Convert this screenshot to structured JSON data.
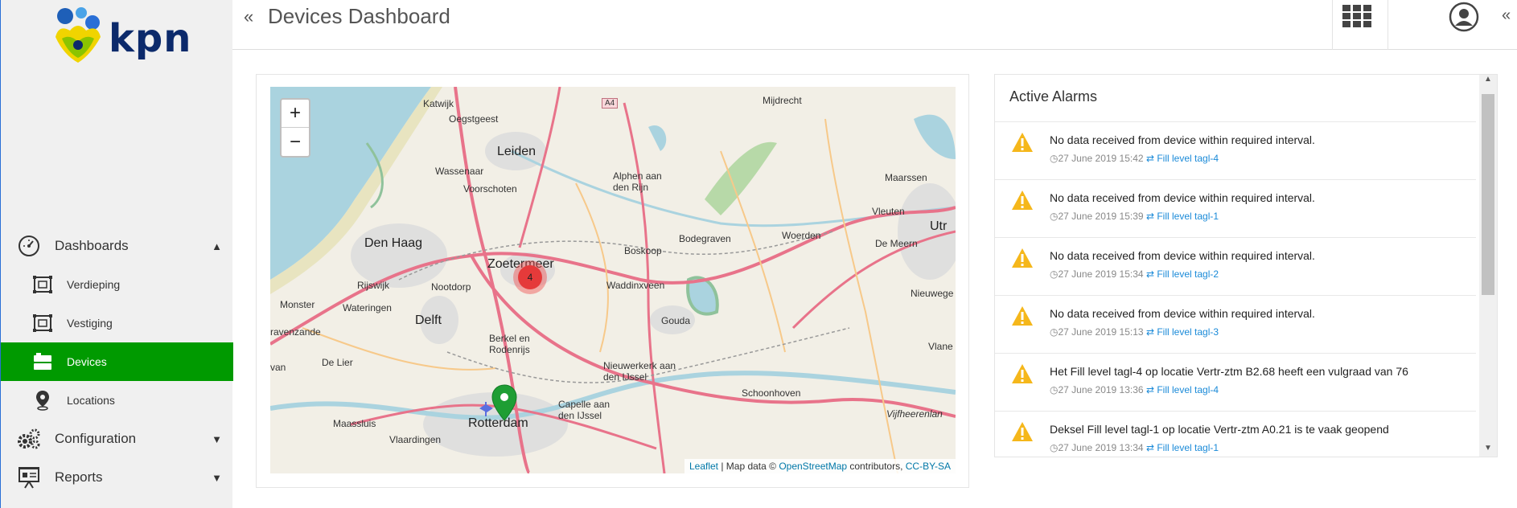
{
  "brand": {
    "name": "kpn",
    "accent": "#009a00",
    "text_color": "#0c2a6b"
  },
  "header": {
    "title": "Devices Dashboard",
    "collapse_left": "«",
    "collapse_right": "«"
  },
  "sidebar": {
    "items": [
      {
        "label": "Dashboards",
        "icon": "gauge-icon",
        "chevron": "up"
      },
      {
        "label": "Verdieping",
        "icon": "floor-plan-icon"
      },
      {
        "label": "Vestiging",
        "icon": "floor-plan-icon"
      },
      {
        "label": "Devices",
        "icon": "devices-icon",
        "active": true
      },
      {
        "label": "Locations",
        "icon": "map-pin-icon"
      },
      {
        "label": "Configuration",
        "icon": "gears-icon",
        "chevron": "down"
      },
      {
        "label": "Reports",
        "icon": "presentation-icon",
        "chevron": "down"
      }
    ]
  },
  "map": {
    "zoom_in": "+",
    "zoom_out": "−",
    "cluster_count": "4",
    "attribution": {
      "leaflet": "Leaflet",
      "sep": " | Map data © ",
      "osm": "OpenStreetMap",
      "contrib": " contributors, ",
      "license": "CC-BY-SA"
    },
    "labels": [
      "Katwijk",
      "Oegstgeest",
      "Leiden",
      "Wassenaar",
      "Voorschoten",
      "Alphen aan den Rijn",
      "Mijdrecht",
      "Maarssen",
      "Den Haag",
      "Zoetermeer",
      "Boskoop",
      "Bodegraven",
      "Woerden",
      "Vleuten",
      "De Meern",
      "Utr",
      "Rijswijk",
      "Nootdorp",
      "Waddinxveen",
      "Gouda",
      "Nieuwege",
      "Monster",
      "Wateringen",
      "Delft",
      "ravenzande",
      "Berkel en Rodenrijs",
      "Vlane",
      "De Lier",
      "Nieuwerkerk aan den IJssel",
      "van",
      "Schoonhoven",
      "Capelle aan den IJssel",
      "Maassluis",
      "Rotterdam",
      "Vlaardingen",
      "Vijfheerenlan",
      "A4"
    ]
  },
  "alarms": {
    "title": "Active Alarms",
    "items": [
      {
        "message": "No data received from device within required interval.",
        "time": "27 June 2019 15:42",
        "device": "Fill level tagl-4"
      },
      {
        "message": "No data received from device within required interval.",
        "time": "27 June 2019 15:39",
        "device": "Fill level tagl-1"
      },
      {
        "message": "No data received from device within required interval.",
        "time": "27 June 2019 15:34",
        "device": "Fill level tagl-2"
      },
      {
        "message": "No data received from device within required interval.",
        "time": "27 June 2019 15:13",
        "device": "Fill level tagl-3"
      },
      {
        "message": "Het Fill level tagl-4 op locatie Vertr-ztm B2.68 heeft een vulgraad van 76",
        "time": "27 June 2019 13:36",
        "device": "Fill level tagl-4"
      },
      {
        "message": "Deksel Fill level tagl-1 op locatie Vertr-ztm A0.21 is te vaak geopend",
        "time": "27 June 2019 13:34",
        "device": "Fill level tagl-1"
      }
    ]
  }
}
